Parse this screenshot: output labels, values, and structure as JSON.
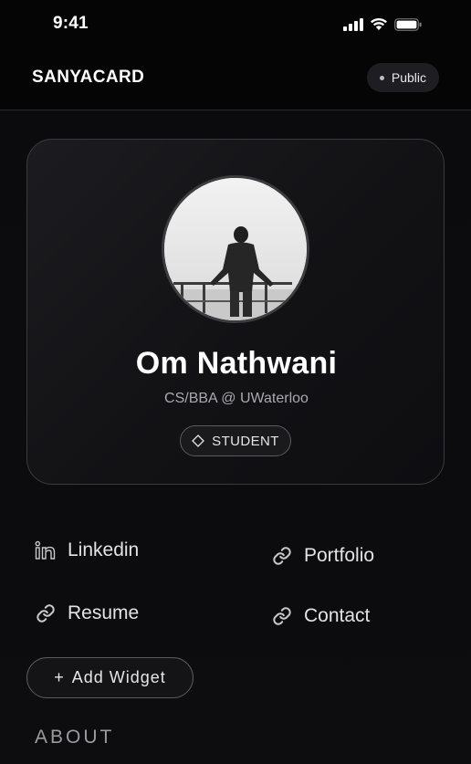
{
  "status_bar": {
    "time": "9:41"
  },
  "header": {
    "brand": "SANYACARD",
    "visibility": "Public"
  },
  "profile": {
    "name": "Om Nathwani",
    "title": "CS/BBA @ UWaterloo",
    "role": "STUDENT"
  },
  "links": [
    {
      "label": "Linkedin",
      "icon": "linkedin-icon"
    },
    {
      "label": "Portfolio",
      "icon": "link-icon"
    },
    {
      "label": "Resume",
      "icon": "link-icon"
    },
    {
      "label": "Contact",
      "icon": "link-icon"
    }
  ],
  "add_widget": {
    "label": "Add Widget",
    "icon": "plus"
  },
  "sections": {
    "about": "ABOUT"
  }
}
